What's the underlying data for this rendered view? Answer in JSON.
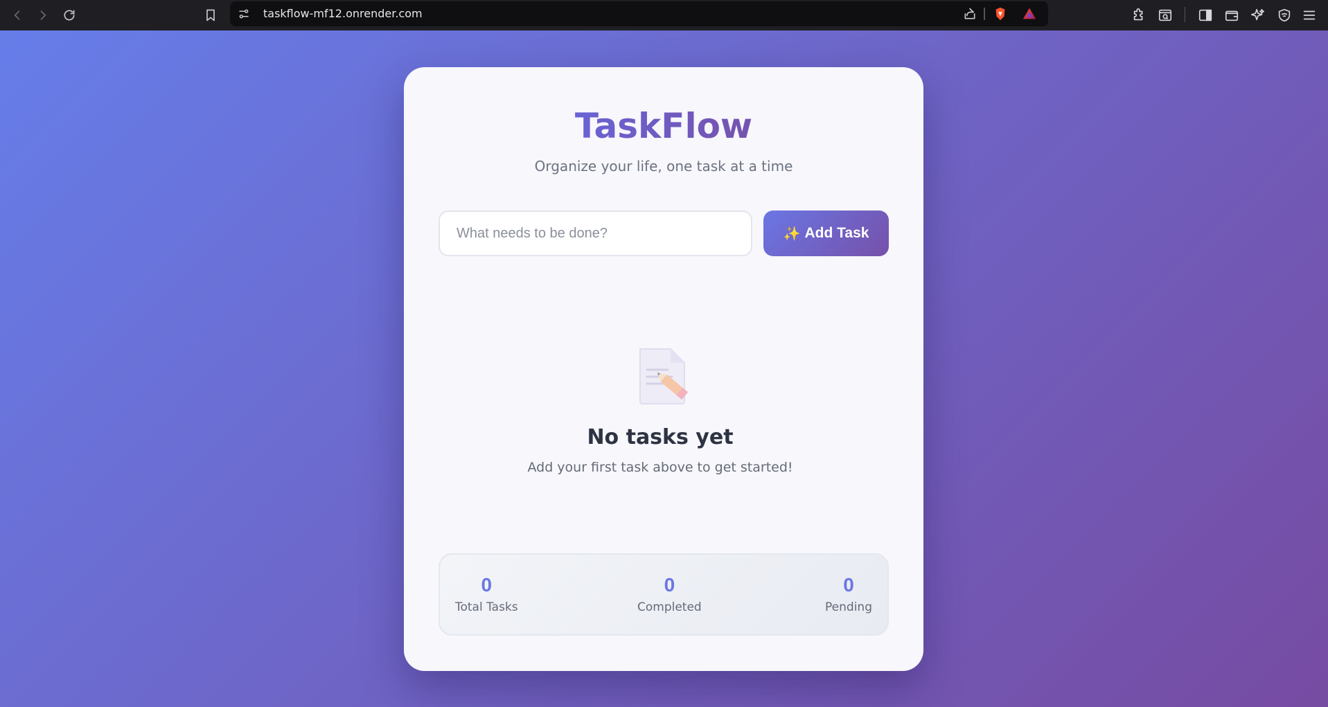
{
  "browser": {
    "url": "taskflow-mf12.onrender.com",
    "icons": [
      "back-icon",
      "forward-icon",
      "reload-icon",
      "bookmark-icon",
      "site-settings-icon",
      "share-icon",
      "brave-shields-icon",
      "brave-rewards-icon",
      "extensions-icon",
      "reader-mode-icon",
      "sidebar-icon",
      "wallet-icon",
      "leo-ai-icon",
      "vpn-icon",
      "menu-icon"
    ]
  },
  "app": {
    "title": "TaskFlow",
    "subtitle": "Organize your life, one task at a time"
  },
  "task_form": {
    "input_value": "",
    "input_placeholder": "What needs to be done?",
    "add_button_icon": "✨",
    "add_button_label": "Add Task"
  },
  "empty_state": {
    "icon": "memo-icon",
    "title": "No tasks yet",
    "message": "Add your first task above to get started!"
  },
  "stats": [
    {
      "value": "0",
      "label": "Total Tasks"
    },
    {
      "value": "0",
      "label": "Completed"
    },
    {
      "value": "0",
      "label": "Pending"
    }
  ],
  "colors": {
    "background_start": "#667eea",
    "background_end": "#764ba2",
    "accent": "#6a76e4",
    "card": "#f7f7fc"
  }
}
